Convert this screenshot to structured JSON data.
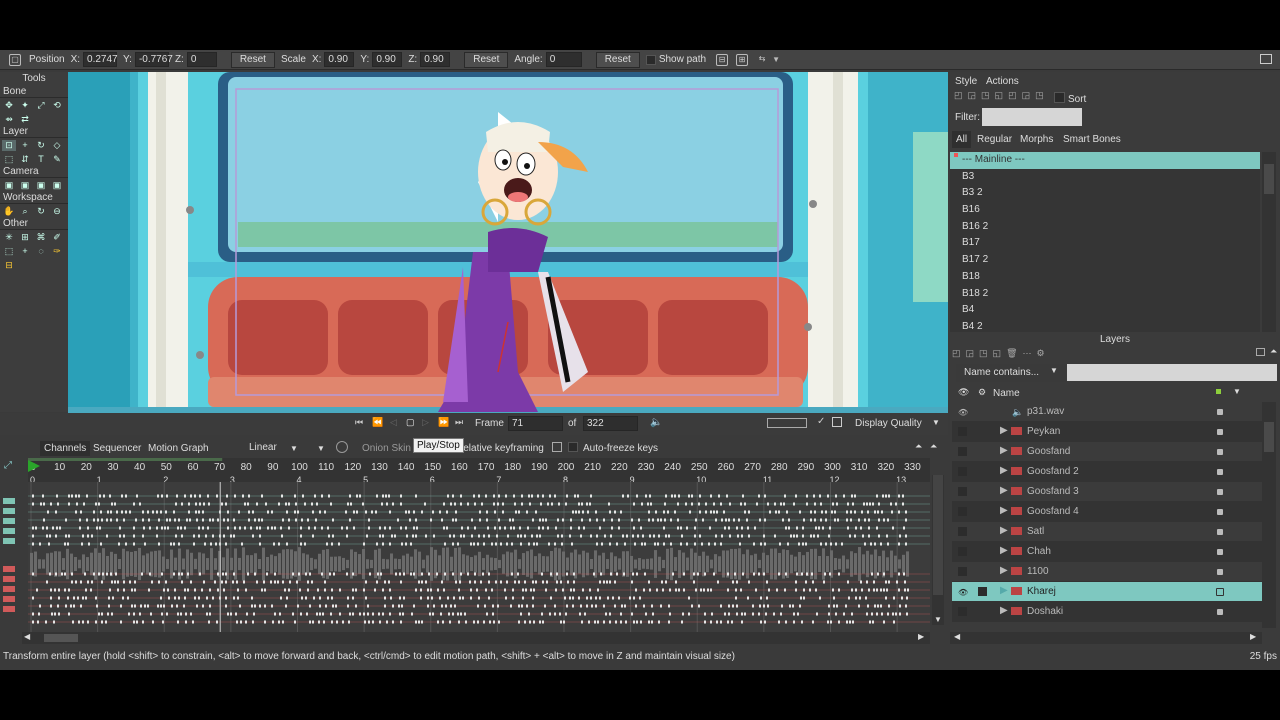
{
  "toolbar": {
    "position_label": "Position",
    "x_label": "X:",
    "x_value": "0.2747",
    "y_label": "Y:",
    "y_value": "-0.7767",
    "z_label": "Z:",
    "z_value": "0",
    "reset1": "Reset",
    "scale_label": "Scale",
    "sx_label": "X:",
    "sx_value": "0.90",
    "sy_label": "Y:",
    "sy_value": "0.90",
    "sz_label": "Z:",
    "sz_value": "0.90",
    "reset2": "Reset",
    "angle_label": "Angle:",
    "angle_value": "0",
    "reset3": "Reset",
    "show_path": "Show path"
  },
  "tools": {
    "title": "Tools",
    "sections": [
      "Bone",
      "Layer",
      "Camera",
      "Workspace",
      "Other"
    ]
  },
  "playback": {
    "frame_label": "Frame",
    "frame_value": "71",
    "of_label": "of",
    "total_frames": "322",
    "tooltip": "Play/Stop",
    "display_quality": "Display Quality"
  },
  "timeline": {
    "tabs": [
      "Channels",
      "Sequencer",
      "Motion Graph"
    ],
    "interp": "Linear",
    "onion": "Onion Skin",
    "relative": "Relative keyframing",
    "autofreeze": "Auto-freeze keys",
    "ruler_frames": [
      "0",
      "10",
      "20",
      "30",
      "40",
      "50",
      "60",
      "70",
      "80",
      "90",
      "100",
      "110",
      "120",
      "130",
      "140",
      "150",
      "160",
      "170",
      "180",
      "190",
      "200",
      "210",
      "220",
      "230",
      "240",
      "250",
      "260",
      "270",
      "280",
      "290",
      "300",
      "310",
      "320",
      "330"
    ],
    "seconds": [
      "0",
      "1",
      "2",
      "3",
      "4",
      "5",
      "6",
      "7",
      "8",
      "9",
      "10",
      "11",
      "12",
      "13"
    ],
    "current_frame": 71
  },
  "status": {
    "message": "Transform entire layer (hold <shift> to constrain, <alt> to move forward and back, <ctrl/cmd> to edit motion path, <shift> + <alt> to move in Z and maintain visual size)",
    "fps": "25 fps"
  },
  "right": {
    "tabs": [
      "Style",
      "Actions"
    ],
    "sort": "Sort",
    "filter_label": "Filter:",
    "filter_tabs": [
      "All",
      "Regular",
      "Morphs",
      "Smart Bones"
    ],
    "actions": [
      "--- Mainline ---",
      "B3",
      "B3 2",
      "B16",
      "B16 2",
      "B17",
      "B17 2",
      "B18",
      "B18 2",
      "B4",
      "B4 2"
    ],
    "layers_title": "Layers",
    "name_contains": "Name contains...",
    "name_header": "Name",
    "layers": [
      "p31.wav",
      "Peykan",
      "Goosfand",
      "Goosfand 2",
      "Goosfand 3",
      "Goosfand 4",
      "Satl",
      "Chah",
      "1100",
      "Kharej",
      "Doshaki"
    ]
  },
  "colors": {
    "accent": "#7ec8c0",
    "sky": "#5ad0df",
    "bench": "#d66b5a",
    "playhead": "#2aa52a"
  }
}
